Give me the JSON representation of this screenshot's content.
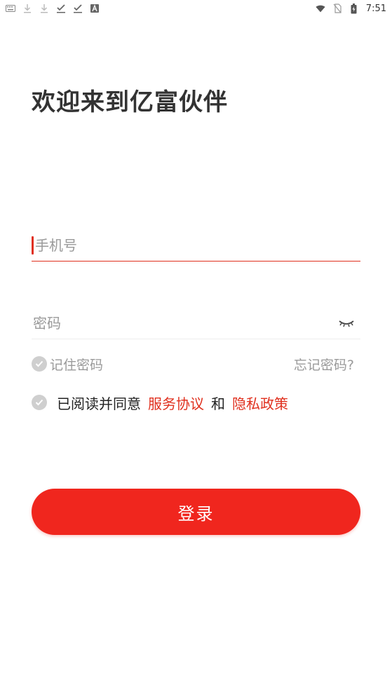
{
  "status_bar": {
    "time": "7:51",
    "left_icons": [
      "keyboard-icon",
      "download-icon",
      "download-icon",
      "check-download-icon",
      "check-download-icon",
      "accessibility-icon"
    ],
    "right_icons": [
      "wifi-icon",
      "no-sim-icon",
      "battery-icon"
    ]
  },
  "page": {
    "title": "欢迎来到亿富伙伴"
  },
  "form": {
    "phone_placeholder": "手机号",
    "phone_value": "",
    "password_placeholder": "密码",
    "password_value": "",
    "remember_label": "记住密码",
    "forgot_label": "忘记密码?",
    "agree_text": "已阅读并同意",
    "service_link": "服务协议",
    "and_text": "和",
    "privacy_link": "隐私政策",
    "login_label": "登录"
  },
  "colors": {
    "accent": "#f0261e",
    "link": "#e0301e",
    "muted": "#9a9a9a",
    "check_bg": "#cfcfcf"
  }
}
